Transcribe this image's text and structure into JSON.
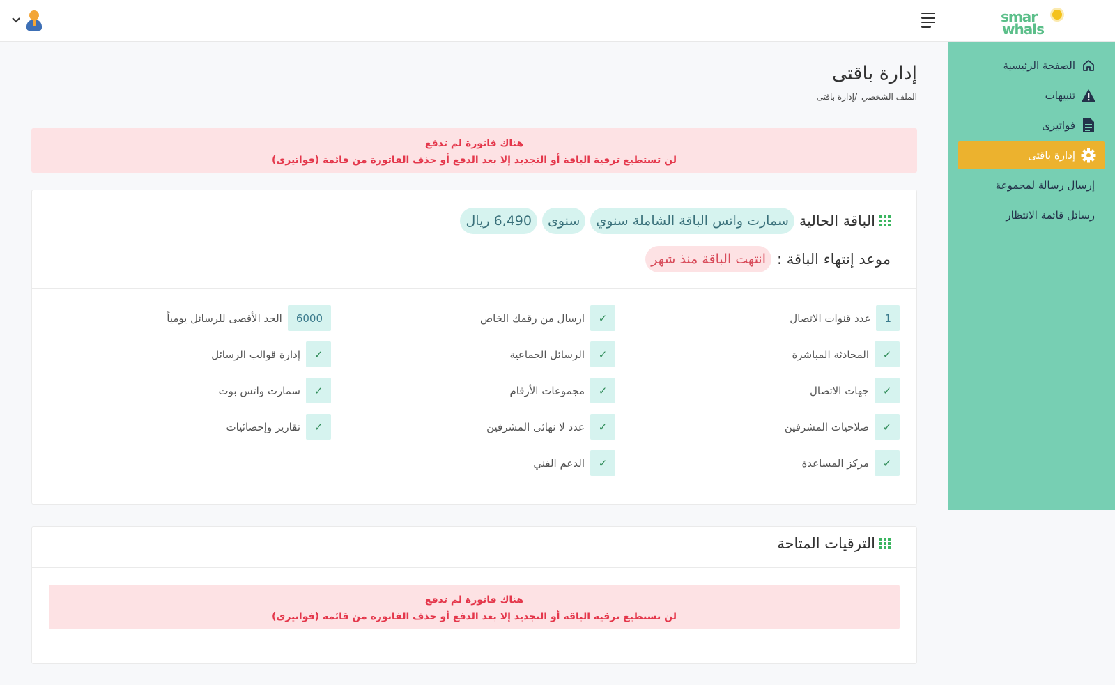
{
  "header": {
    "logo_line1": "smar",
    "logo_line2": "whals"
  },
  "sidebar": {
    "items": [
      {
        "label": "الصفحة الرئيسية",
        "icon": "home-icon"
      },
      {
        "label": "تنبيهات",
        "icon": "warning-icon"
      },
      {
        "label": "فواتيرى",
        "icon": "invoice-icon"
      },
      {
        "label": "إدارة باقتى",
        "icon": "gear-icon",
        "active": true
      },
      {
        "label": "إرسال رسالة لمجموعة"
      },
      {
        "label": "رسائل قائمة الانتظار"
      }
    ],
    "bg_color": "#77cfb3",
    "active_color": "#ecb22e"
  },
  "page": {
    "title": "إدارة باقتى",
    "breadcrumb": [
      "الملف الشخصي",
      "/إدارة باقتى"
    ]
  },
  "alert": {
    "line1": "هناك فاتورة لم تدفع",
    "line2": "لن تستطيع ترقية الباقة أو التجديد إلا بعد الدفع أو حذف الفاتورة من قائمة (فواتيرى)"
  },
  "current_plan": {
    "label": "الباقة الحالية",
    "name": "سمارت واتس الباقة الشاملة سنوي",
    "period": "سنوى",
    "price": "6,490 ريال",
    "expire_label": "موعد إنتهاء الباقة :",
    "expire_value": "انتهت الباقة منذ شهر"
  },
  "features": {
    "col1": [
      {
        "badge": "1",
        "label": "عدد قنوات الاتصال"
      },
      {
        "badge": "✓",
        "label": "المحادثة المباشرة"
      },
      {
        "badge": "✓",
        "label": "جهات الاتصال"
      },
      {
        "badge": "✓",
        "label": "صلاحيات المشرفين"
      },
      {
        "badge": "✓",
        "label": "مركز المساعدة"
      }
    ],
    "col2": [
      {
        "badge": "✓",
        "label": "ارسال من رقمك الخاص"
      },
      {
        "badge": "✓",
        "label": "الرسائل الجماعية"
      },
      {
        "badge": "✓",
        "label": "مجموعات الأرقام"
      },
      {
        "badge": "✓",
        "label": "عدد لا نهائى المشرفين"
      },
      {
        "badge": "✓",
        "label": "الدعم الفني"
      }
    ],
    "col3": [
      {
        "badge": "6000",
        "label": "الحد الأقصى للرسائل يومياً"
      },
      {
        "badge": "✓",
        "label": "إدارة قوالب الرسائل"
      },
      {
        "badge": "✓",
        "label": "سمارت واتس بوت"
      },
      {
        "badge": "✓",
        "label": "تقارير وإحصائيات"
      }
    ]
  },
  "upgrades": {
    "title": "الترقيات المتاحة"
  }
}
